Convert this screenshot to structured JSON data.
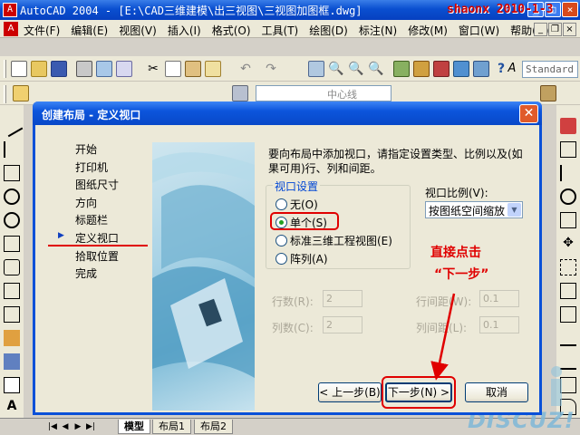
{
  "app": {
    "title": "AutoCAD 2004 - [E:\\CAD三维建模\\出三视图\\三视图加图框.dwg]",
    "watermark_top": "shaonx 2010-1-3",
    "watermark_bottom": "DISCUZ!"
  },
  "menu": {
    "items": [
      "文件(F)",
      "编辑(E)",
      "视图(V)",
      "插入(I)",
      "格式(O)",
      "工具(T)",
      "绘图(D)",
      "标注(N)",
      "修改(M)",
      "窗口(W)",
      "帮助(H)"
    ]
  },
  "toolbar": {
    "text_style": "Standard",
    "layer": "中心线"
  },
  "layout_tabs": [
    "模型",
    "布局1",
    "布局2"
  ],
  "dialog": {
    "title": "创建布局 - 定义视口",
    "steps": [
      "开始",
      "打印机",
      "图纸尺寸",
      "方向",
      "标题栏",
      "定义视口",
      "拾取位置",
      "完成"
    ],
    "current_step": "定义视口",
    "intro": "要向布局中添加视口，请指定设置类型、比例以及(如果可用)行、列和间距。",
    "viewport_group": {
      "legend": "视口设置",
      "options": [
        "无(O)",
        "单个(S)",
        "标准三维工程视图(E)",
        "阵列(A)"
      ],
      "selected": "单个(S)"
    },
    "scale": {
      "label": "视口比例(V):",
      "value": "按图纸空间缩放"
    },
    "grid": {
      "rows_label": "行数(R):",
      "rows_value": "2",
      "cols_label": "列数(C):",
      "cols_value": "2",
      "row_spacing_label": "行间距(W):",
      "row_spacing_value": "0.1",
      "col_spacing_label": "列间距(L):",
      "col_spacing_value": "0.1"
    },
    "annotation": {
      "line1": "直接点击",
      "line2": "“下一步”",
      "color": "#e00000"
    },
    "buttons": {
      "back": "< 上一步(B)",
      "next": "下一步(N) >",
      "cancel": "取消"
    }
  }
}
